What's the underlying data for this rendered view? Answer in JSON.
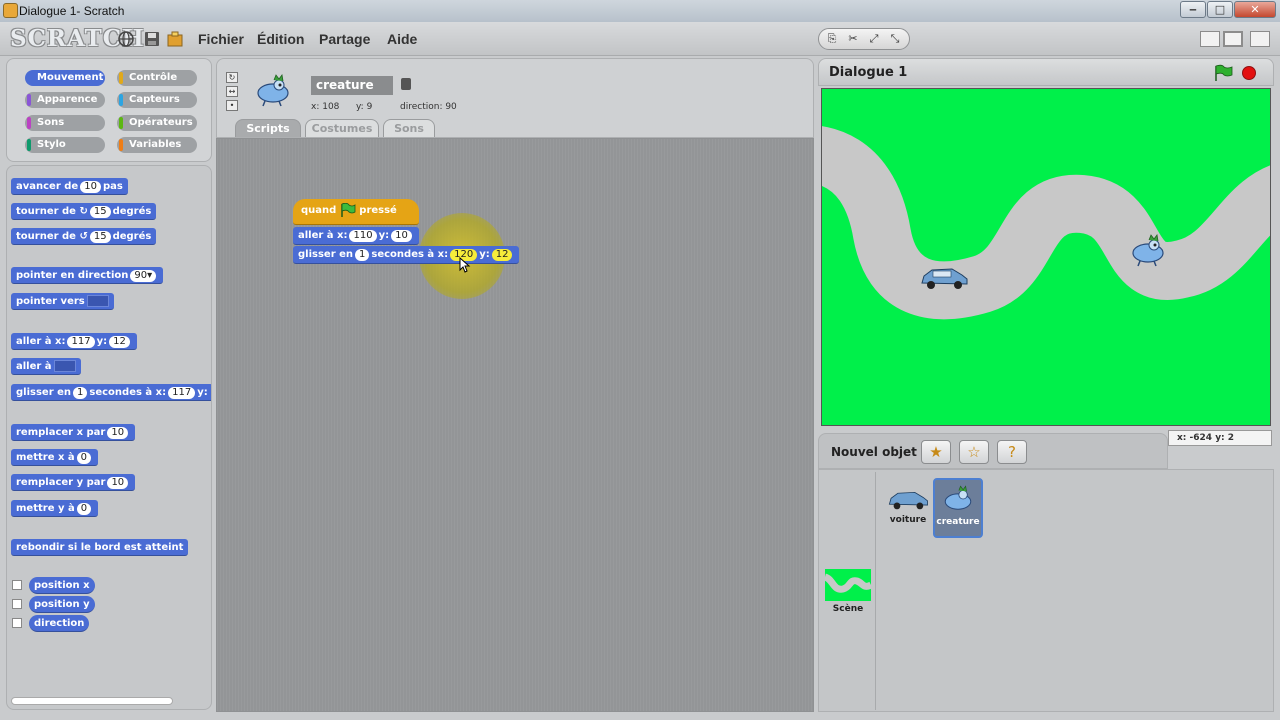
{
  "window": {
    "title": "Dialogue 1- Scratch",
    "buttons": {
      "minimize": "‒",
      "maximize": "□",
      "close": "✕"
    }
  },
  "menubar": {
    "logo": "SCRATCH",
    "items": [
      "Fichier",
      "Édition",
      "Partage",
      "Aide"
    ]
  },
  "categories": [
    {
      "label": "Mouvement",
      "selected": true
    },
    {
      "label": "Contrôle"
    },
    {
      "label": "Apparence"
    },
    {
      "label": "Capteurs"
    },
    {
      "label": "Sons"
    },
    {
      "label": "Opérateurs"
    },
    {
      "label": "Stylo"
    },
    {
      "label": "Variables"
    }
  ],
  "palette": {
    "move": {
      "pre": "avancer de",
      "n": "10",
      "post": "pas"
    },
    "turn_r": {
      "pre": "tourner de ↻",
      "n": "15",
      "post": "degrés"
    },
    "turn_l": {
      "pre": "tourner de ↺",
      "n": "15",
      "post": "degrés"
    },
    "point_dir": {
      "pre": "pointer en direction",
      "n": "90▾"
    },
    "point_to": {
      "pre": "pointer vers"
    },
    "goto_xy": {
      "pre": "aller à x:",
      "x": "117",
      "mid": "y:",
      "y": "12"
    },
    "goto": {
      "pre": "aller à"
    },
    "glide": {
      "pre": "glisser en",
      "n": "1",
      "mid": "secondes à x:",
      "x": "117",
      "post": "y:"
    },
    "set_x_by": {
      "pre": "remplacer x par",
      "n": "10"
    },
    "set_x": {
      "pre": "mettre x à",
      "n": "0"
    },
    "set_y_by": {
      "pre": "remplacer y par",
      "n": "10"
    },
    "set_y": {
      "pre": "mettre y à",
      "n": "0"
    },
    "bounce": "rebondir si le bord est atteint",
    "reporters": [
      "position x",
      "position y",
      "direction"
    ]
  },
  "sprite": {
    "name": "creature",
    "x_label": "x: 108",
    "y_label": "y: 9",
    "direction_label": "direction: 90",
    "tabs": [
      "Scripts",
      "Costumes",
      "Sons"
    ]
  },
  "script": {
    "hat": {
      "pre": "quand",
      "post": "pressé"
    },
    "goto": {
      "pre": "aller à x:",
      "x": "110",
      "mid": "y:",
      "y": "10"
    },
    "glide": {
      "pre": "glisser en",
      "n": "1",
      "mid": "secondes à x:",
      "x": "120",
      "mid2": "y:",
      "y": "12"
    }
  },
  "stage": {
    "title": "Dialogue 1",
    "coords": "x: -624  y: 2"
  },
  "sprites_panel": {
    "new_label": "Nouvel objet",
    "sprites": [
      {
        "name": "voiture"
      },
      {
        "name": "creature",
        "selected": true
      }
    ],
    "stage_label": "Scène"
  },
  "colors": {
    "motion": "#4a6cd4",
    "control": "#e5a415",
    "stage_bg": "#00f04a",
    "road": "#c8c8c8"
  }
}
